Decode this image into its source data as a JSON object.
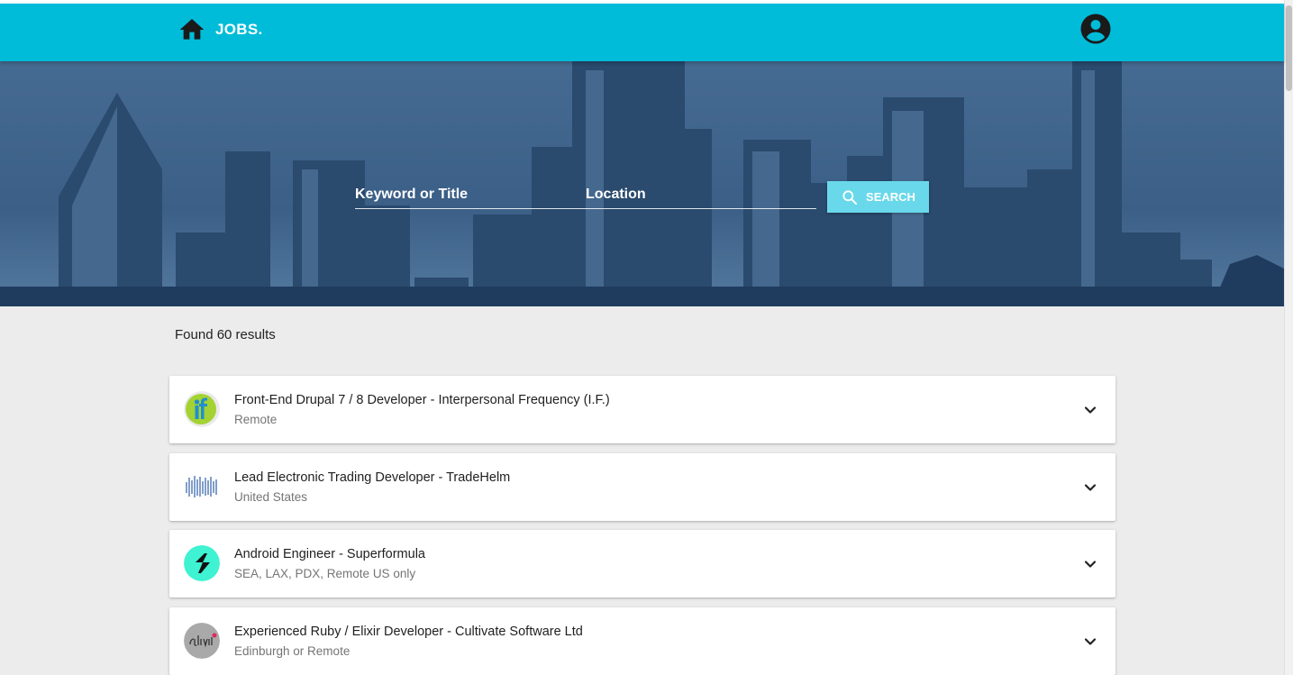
{
  "header": {
    "brand": "JOBS.",
    "home_icon": "home-icon",
    "account_icon": "account-circle-icon",
    "bar_color": "#00bcd9"
  },
  "search": {
    "keyword_placeholder": "Keyword or Title",
    "location_placeholder": "Location",
    "button_label": "SEARCH",
    "button_icon": "search-icon",
    "button_color": "#69d8ea"
  },
  "results": {
    "count_text": "Found 60 results",
    "jobs": [
      {
        "title": "Front-End Drupal 7 / 8 Developer - Interpersonal Frequency (I.F.)",
        "location": "Remote",
        "logo": "if-logo"
      },
      {
        "title": "Lead Electronic Trading Developer - TradeHelm",
        "location": "United States",
        "logo": "tradehelm-logo"
      },
      {
        "title": "Android Engineer - Superformula",
        "location": "SEA, LAX, PDX, Remote US only",
        "logo": "superformula-logo"
      },
      {
        "title": "Experienced Ruby / Elixir Developer - Cultivate Software Ltd",
        "location": "Edinburgh or Remote",
        "logo": "cultivate-logo"
      }
    ],
    "expand_icon": "chevron-down-icon"
  }
}
